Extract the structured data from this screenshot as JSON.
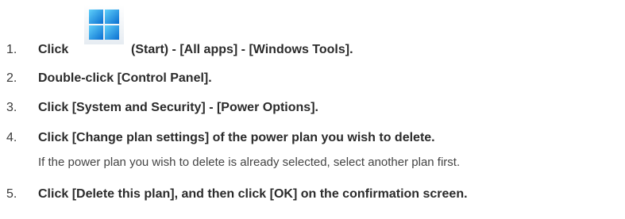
{
  "steps": [
    {
      "number": "1.",
      "text_before": "Click",
      "icon": "windows-start-icon",
      "text_after": "(Start) - [All apps] - [Windows Tools]."
    },
    {
      "number": "2.",
      "text": "Double-click [Control Panel]."
    },
    {
      "number": "3.",
      "text": "Click [System and Security] - [Power Options]."
    },
    {
      "number": "4.",
      "text": "Click [Change plan settings] of the power plan you wish to delete.",
      "note": "If the power plan you wish to delete is already selected, select another plan first."
    },
    {
      "number": "5.",
      "text": "Click [Delete this plan], and then click [OK] on the confirmation screen."
    }
  ],
  "colors": {
    "text": "#2b2b2b",
    "icon_blue_light": "#4fc3f7",
    "icon_blue_dark": "#0078d4"
  }
}
